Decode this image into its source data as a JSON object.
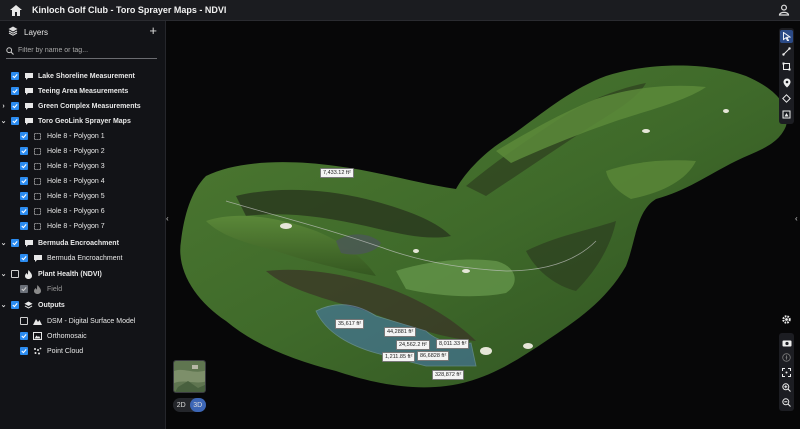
{
  "header": {
    "title": "Kinloch Golf Club - Toro Sprayer Maps - NDVI"
  },
  "sidebar": {
    "heading": "Layers",
    "search_placeholder": "Filter by name or tag...",
    "items": [
      {
        "label": "Lake Shoreline Measurement",
        "bold": true
      },
      {
        "label": "Teeing Area Measurements",
        "bold": true
      },
      {
        "label": "Green Complex Measurements",
        "bold": true
      },
      {
        "label": "Toro GeoLink Sprayer Maps",
        "bold": true
      },
      {
        "label": "Hole 8 - Polygon 1",
        "bold": false
      },
      {
        "label": "Hole 8 - Polygon 2",
        "bold": false
      },
      {
        "label": "Hole 8 - Polygon 3",
        "bold": false
      },
      {
        "label": "Hole 8 - Polygon 4",
        "bold": false
      },
      {
        "label": "Hole 8 - Polygon 5",
        "bold": false
      },
      {
        "label": "Hole 8 - Polygon 6",
        "bold": false
      },
      {
        "label": "Hole 8 - Polygon 7",
        "bold": false
      },
      {
        "label": "Bermuda Encroachment",
        "bold": true
      },
      {
        "label": "Bermuda Encroachment",
        "bold": false
      },
      {
        "label": "Plant Health (NDVI)",
        "bold": true
      },
      {
        "label": "Field",
        "bold": false
      },
      {
        "label": "Outputs",
        "bold": true
      },
      {
        "label": "DSM - Digital Surface Model",
        "bold": false
      },
      {
        "label": "Orthomosaic",
        "bold": false
      },
      {
        "label": "Point Cloud",
        "bold": false
      }
    ]
  },
  "map": {
    "view_2d": "2D",
    "view_3d": "3D",
    "measurements": [
      "7,433.12 ft²",
      "35,617 ft²",
      "44,2881 ft²",
      "24,562.2 ft²",
      "8,011.33 ft²",
      "1,211.85 ft²",
      "86,6828 ft²",
      "328,872 ft²"
    ]
  },
  "colors": {
    "accent": "#2b8cf0",
    "toolbar_active": "#2b4a86"
  }
}
